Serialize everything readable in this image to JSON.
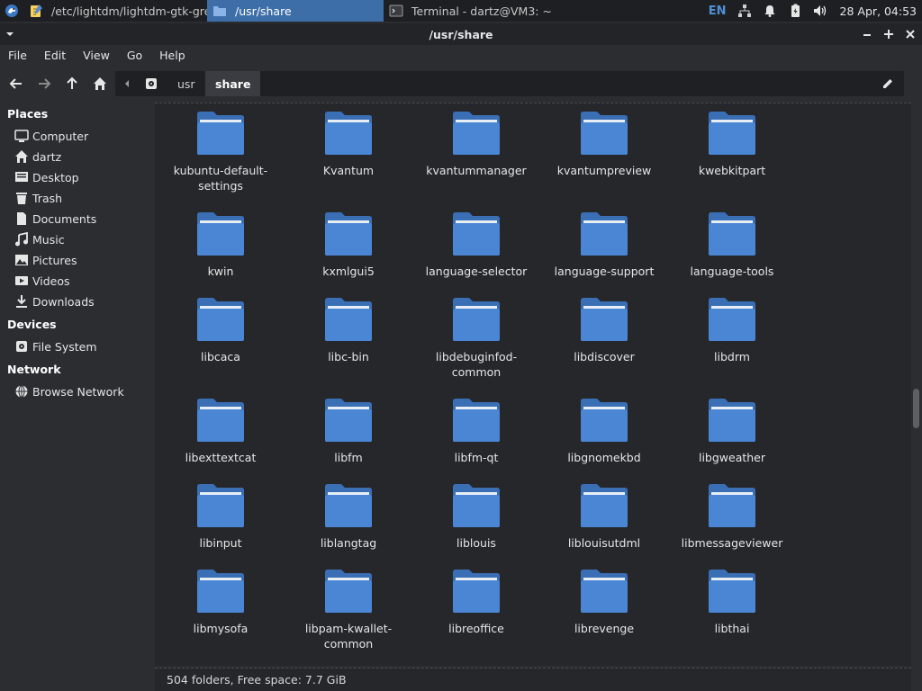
{
  "taskbar": {
    "tasks": [
      {
        "label": "/etc/lightdm/lightdm-gtk-gre...",
        "icon": "text-editor-icon"
      },
      {
        "label": "/usr/share",
        "icon": "folder-icon",
        "active": true
      },
      {
        "label": "Terminal - dartz@VM3: ~",
        "icon": "terminal-icon"
      }
    ],
    "tray": {
      "keyboard_layout": "EN",
      "clock": "28 Apr, 04:53"
    }
  },
  "window": {
    "title": "/usr/share"
  },
  "menubar": {
    "items": [
      "File",
      "Edit",
      "View",
      "Go",
      "Help"
    ]
  },
  "pathbar": {
    "crumbs": [
      "usr",
      "share"
    ]
  },
  "sidebar": {
    "sections": [
      {
        "heading": "Places",
        "items": [
          {
            "label": "Computer",
            "icon": "computer-icon"
          },
          {
            "label": "dartz",
            "icon": "home-icon"
          },
          {
            "label": "Desktop",
            "icon": "desktop-icon"
          },
          {
            "label": "Trash",
            "icon": "trash-icon"
          },
          {
            "label": "Documents",
            "icon": "document-icon"
          },
          {
            "label": "Music",
            "icon": "music-icon"
          },
          {
            "label": "Pictures",
            "icon": "pictures-icon"
          },
          {
            "label": "Videos",
            "icon": "videos-icon"
          },
          {
            "label": "Downloads",
            "icon": "download-icon"
          }
        ]
      },
      {
        "heading": "Devices",
        "items": [
          {
            "label": "File System",
            "icon": "drive-icon"
          }
        ]
      },
      {
        "heading": "Network",
        "items": [
          {
            "label": "Browse Network",
            "icon": "network-icon"
          }
        ]
      }
    ]
  },
  "folders": [
    "kubuntu-default-settings",
    "Kvantum",
    "kvantummanager",
    "kvantumpreview",
    "kwebkitpart",
    "kwin",
    "kxmlgui5",
    "language-selector",
    "language-support",
    "language-tools",
    "libcaca",
    "libc-bin",
    "libdebuginfod-common",
    "libdiscover",
    "libdrm",
    "libexttextcat",
    "libfm",
    "libfm-qt",
    "libgnomekbd",
    "libgweather",
    "libinput",
    "liblangtag",
    "liblouis",
    "liblouisutdml",
    "libmessageviewer",
    "libmysofa",
    "libpam-kwallet-common",
    "libreoffice",
    "librevenge",
    "libthai"
  ],
  "status": {
    "text": "504 folders, Free space: 7.7 GiB"
  },
  "colors": {
    "accent": "#3d6ea8",
    "folder": "#4a86d4",
    "background": "#2b2d31"
  }
}
